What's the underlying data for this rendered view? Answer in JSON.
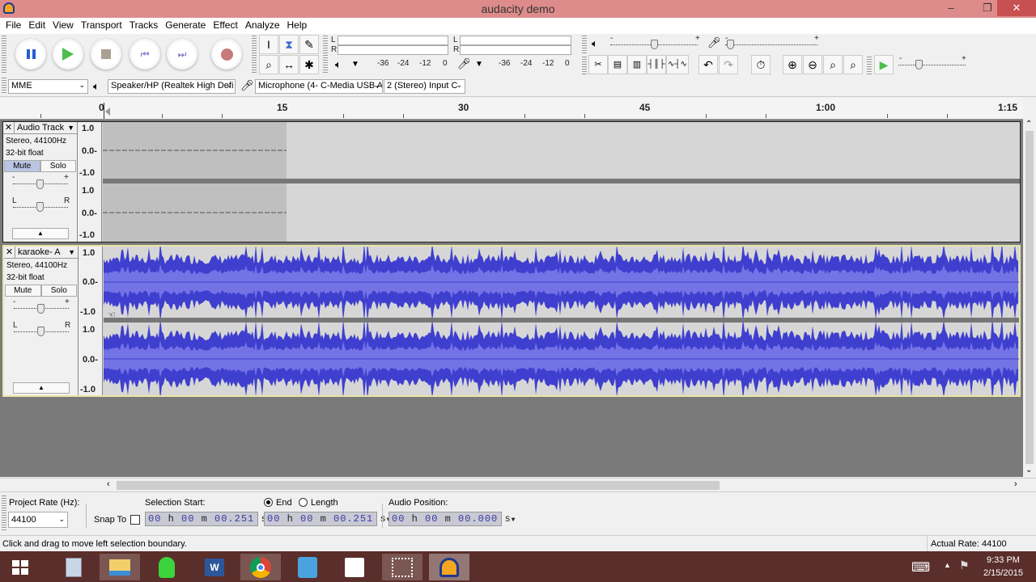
{
  "window": {
    "title": "audacity demo",
    "minimize": "–",
    "restore": "❐",
    "close": "✕"
  },
  "menu": [
    "File",
    "Edit",
    "View",
    "Transport",
    "Tracks",
    "Generate",
    "Effect",
    "Analyze",
    "Help"
  ],
  "transport": {
    "pause": "pause-icon",
    "play": "play-icon",
    "stop": "stop-icon",
    "skip_start": "skip-start-icon",
    "skip_end": "skip-end-icon",
    "record": "record-icon"
  },
  "tools": {
    "selection": "I",
    "envelope": "⧗",
    "draw": "✎",
    "zoom": "⌕",
    "timeshift": "↔",
    "multi": "✱"
  },
  "meters": {
    "play_channels": [
      "L",
      "R"
    ],
    "rec_channels": [
      "L",
      "R"
    ],
    "play_scale": [
      "-36",
      "-24",
      "-12",
      "0"
    ],
    "rec_scale": [
      "-36",
      "-24",
      "-12",
      "0"
    ]
  },
  "mixer": {
    "minus": "-",
    "plus": "+",
    "output_level": 0.5,
    "input_level": 0.05
  },
  "play_at_speed": {
    "minus": "-",
    "plus": "+",
    "speed": 0.3
  },
  "device": {
    "host": "MME",
    "output": "Speaker/HP (Realtek High Defi",
    "input": "Microphone (4- C-Media USB A",
    "channels": "2 (Stereo) Input C"
  },
  "ruler": {
    "labels": [
      "0",
      "15",
      "30",
      "45",
      "1:00",
      "1:15"
    ]
  },
  "tracks": [
    {
      "name": "Audio Track",
      "info1": "Stereo, 44100Hz",
      "info2": "32-bit float",
      "mute": "Mute",
      "solo": "Solo",
      "mute_active": true,
      "gain_minus": "-",
      "gain_plus": "+",
      "pan_left": "L",
      "pan_right": "R",
      "scale": [
        "1.0",
        "0.0-",
        "-1.0",
        "1.0",
        "0.0-",
        "-1.0"
      ],
      "gain": 0.5,
      "pan": 0.5
    },
    {
      "name": "karaoke- A",
      "info1": "Stereo, 44100Hz",
      "info2": "32-bit float",
      "mute": "Mute",
      "solo": "Solo",
      "mute_active": false,
      "gain_minus": "-",
      "gain_plus": "+",
      "pan_left": "L",
      "pan_right": "R",
      "scale": [
        "1.0",
        "0.0-",
        "-1.0",
        "1.0",
        "0.0-",
        "-1.0"
      ],
      "gain": 0.5,
      "pan": 0.5
    }
  ],
  "selection": {
    "project_rate_label": "Project Rate (Hz):",
    "project_rate": "44100",
    "snap_to": "Snap To",
    "start_label": "Selection Start:",
    "end_label": "End",
    "length_label": "Length",
    "start": {
      "h": "00",
      "m": "00",
      "s": "00.251"
    },
    "end": {
      "h": "00",
      "m": "00",
      "s": "00.251"
    },
    "audio_position_label": "Audio Position:",
    "position": {
      "h": "00",
      "m": "00",
      "s": "00.000"
    },
    "unit_h": "h",
    "unit_m": "m",
    "unit_s": "s"
  },
  "status": {
    "message": "Click and drag to move left selection boundary.",
    "actual_rate": "Actual Rate: 44100"
  },
  "taskbar": {
    "time": "9:33 PM",
    "date": "2/15/2015",
    "apps": [
      "start-icon",
      "notepad-icon",
      "file-explorer-icon",
      "vpn-icon",
      "word-icon",
      "chrome-icon",
      "notes-icon",
      "apps-icon",
      "snipping-tool-icon",
      "audacity-icon"
    ]
  }
}
